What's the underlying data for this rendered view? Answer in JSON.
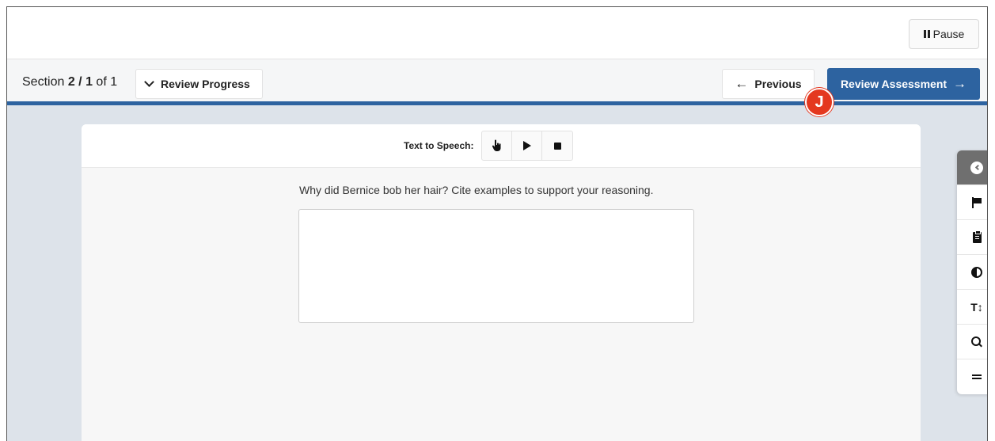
{
  "topbar": {
    "pause_label": "Pause"
  },
  "navbar": {
    "section_prefix": "Section",
    "section_value": "2 / 1",
    "section_suffix": "of 1",
    "review_progress_label": "Review Progress",
    "previous_label": "Previous",
    "review_assessment_label": "Review Assessment"
  },
  "callout": {
    "letter": "J"
  },
  "tts": {
    "label": "Text to Speech:",
    "buttons": [
      "pointer-icon",
      "play-icon",
      "stop-icon"
    ]
  },
  "question": {
    "text": "Why did Bernice bob her hair? Cite examples to support your reasoning.",
    "answer_value": ""
  },
  "toolbar": {
    "tools": [
      "collapse-icon",
      "flag-icon",
      "clipboard-icon",
      "contrast-icon",
      "text-size-icon",
      "search-icon",
      "line-guide-icon"
    ],
    "text_size_glyph": "T↕"
  },
  "colors": {
    "primary": "#2d63a0",
    "badge": "#e4381f",
    "background": "#dde3ea"
  }
}
